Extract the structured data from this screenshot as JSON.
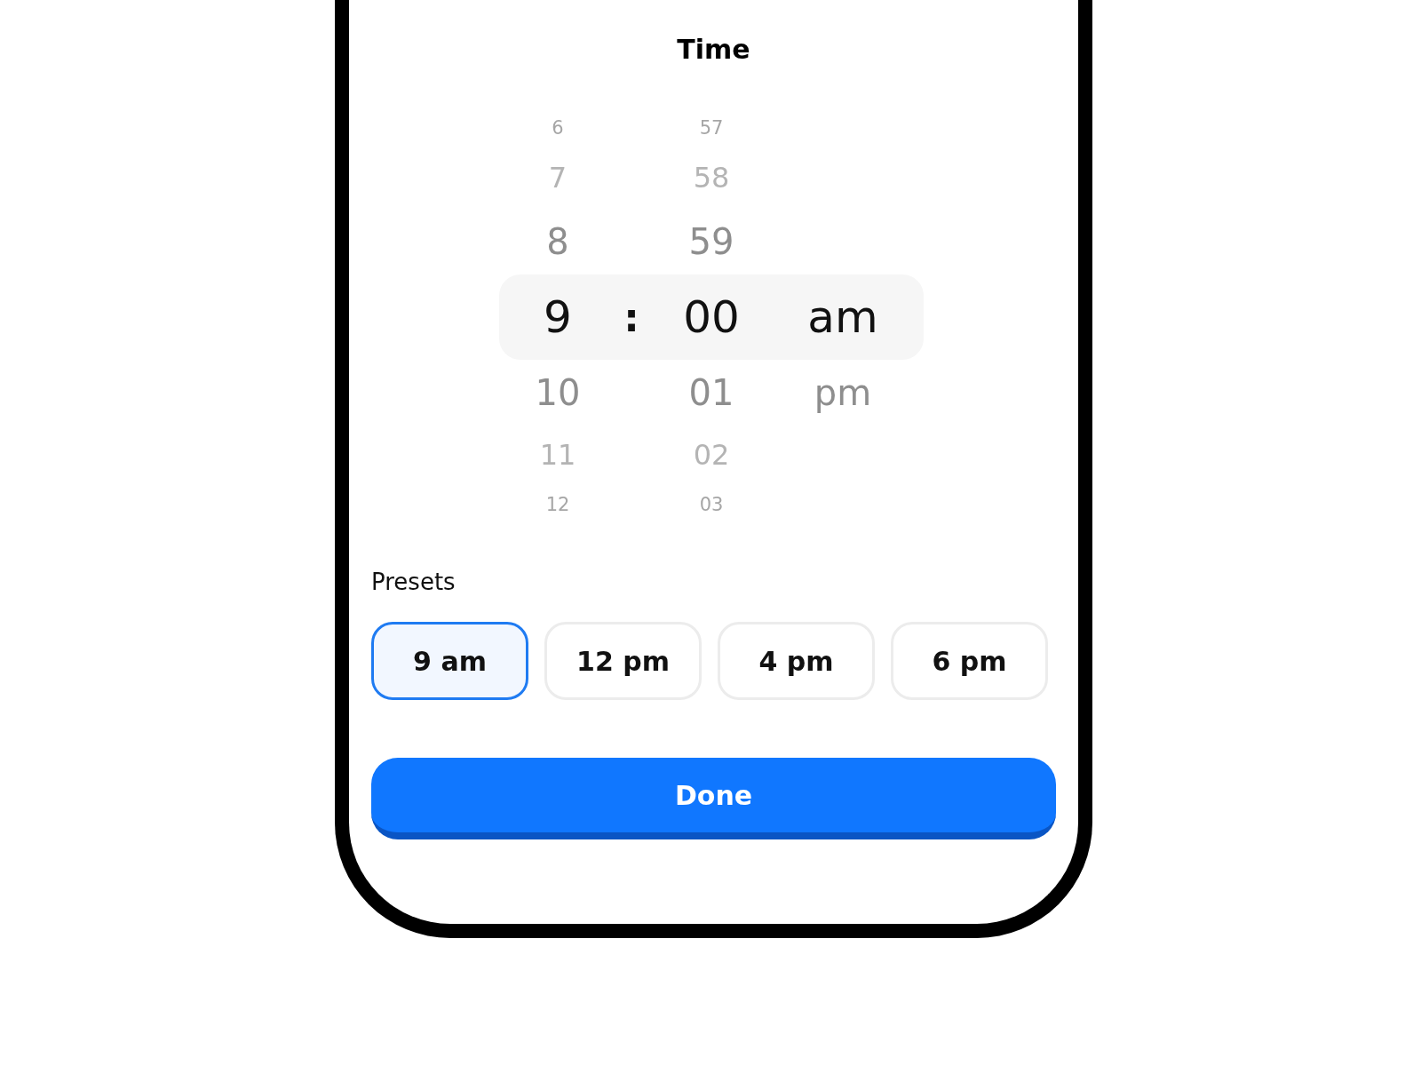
{
  "title": "Time",
  "picker": {
    "separator": ":",
    "columns": [
      {
        "items": [
          {
            "label": "6",
            "selected": false
          },
          {
            "label": "7",
            "selected": false
          },
          {
            "label": "8",
            "selected": false
          },
          {
            "label": "9",
            "selected": true
          },
          {
            "label": "10",
            "selected": false
          },
          {
            "label": "11",
            "selected": false
          },
          {
            "label": "12",
            "selected": false
          }
        ]
      },
      {
        "items": [
          {
            "label": "57",
            "selected": false
          },
          {
            "label": "58",
            "selected": false
          },
          {
            "label": "59",
            "selected": false
          },
          {
            "label": "00",
            "selected": true
          },
          {
            "label": "01",
            "selected": false
          },
          {
            "label": "02",
            "selected": false
          },
          {
            "label": "03",
            "selected": false
          }
        ]
      },
      {
        "items": [
          {
            "label": "am",
            "selected": true
          },
          {
            "label": "pm",
            "selected": false
          }
        ]
      }
    ]
  },
  "presets": {
    "label": "Presets",
    "items": [
      {
        "label": "9 am",
        "selected": true
      },
      {
        "label": "12 pm",
        "selected": false
      },
      {
        "label": "4 pm",
        "selected": false
      },
      {
        "label": "6 pm",
        "selected": false
      }
    ]
  },
  "done_button": "Done"
}
